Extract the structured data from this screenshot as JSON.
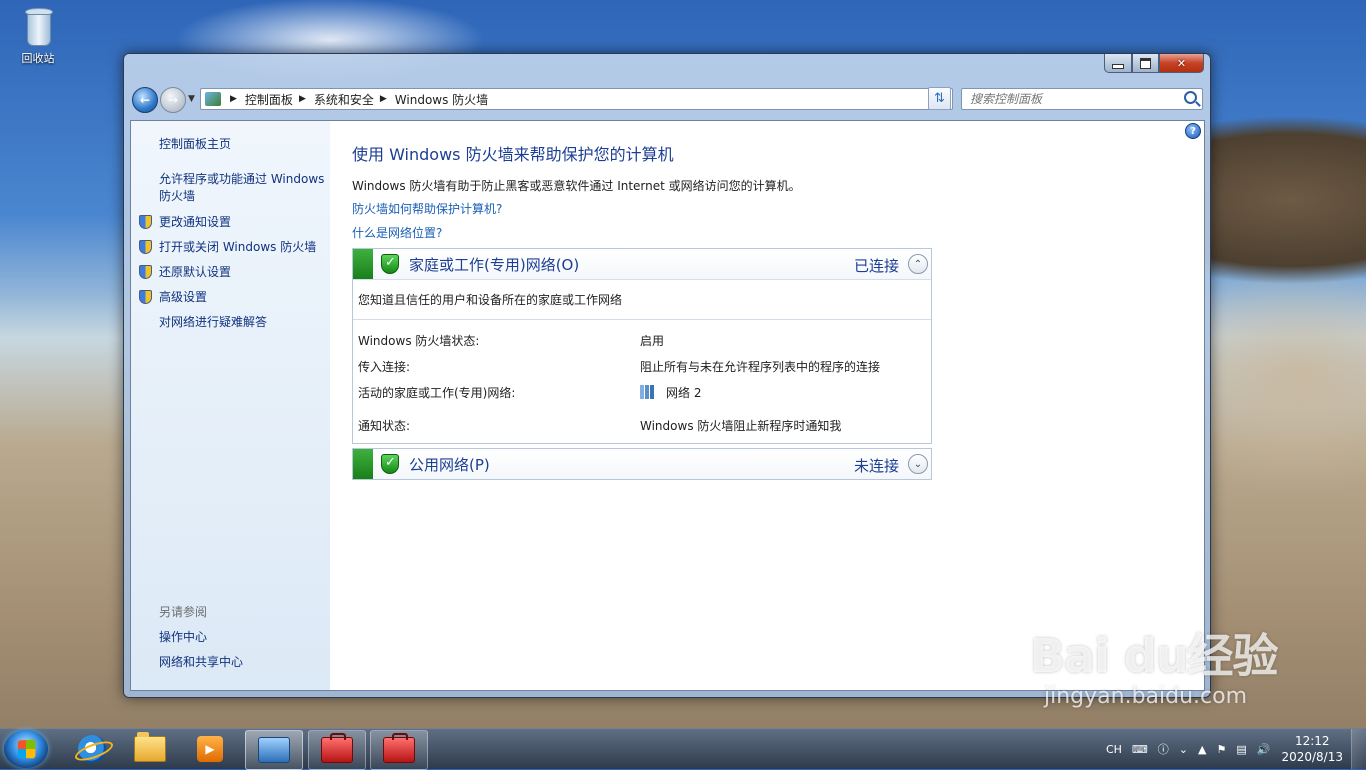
{
  "desktop": {
    "recycle_bin_label": "回收站"
  },
  "window": {
    "caption_buttons": {
      "minimize": "",
      "maximize": "",
      "close": "✕"
    },
    "nav": {
      "breadcrumbs": [
        "控制面板",
        "系统和安全",
        "Windows 防火墙"
      ],
      "search_placeholder": "搜索控制面板"
    },
    "sidebar": {
      "home": "控制面板主页",
      "allow_program": "允许程序或功能通过 Windows 防火墙",
      "items": [
        {
          "label": "更改通知设置",
          "icon": "uac-shield-icon"
        },
        {
          "label": "打开或关闭 Windows 防火墙",
          "icon": "uac-shield-icon"
        },
        {
          "label": "还原默认设置",
          "icon": "uac-shield-icon"
        },
        {
          "label": "高级设置",
          "icon": "uac-shield-icon"
        }
      ],
      "troubleshoot": "对网络进行疑难解答",
      "see_also_title": "另请参阅",
      "see_also": [
        "操作中心",
        "网络和共享中心"
      ]
    },
    "main": {
      "help_icon": "?",
      "title": "使用 Windows 防火墙来帮助保护您的计算机",
      "description": "Windows 防火墙有助于防止黑客或恶意软件通过 Internet 或网络访问您的计算机。",
      "link_how": "防火墙如何帮助保护计算机?",
      "link_location": "什么是网络位置?",
      "panels": [
        {
          "title": "家庭或工作(专用)网络(O)",
          "status": "已连接",
          "expanded": true,
          "chevron": "⌃",
          "subtitle": "您知道且信任的用户和设备所在的家庭或工作网络",
          "rows": [
            {
              "label": "Windows 防火墙状态:",
              "value": "启用"
            },
            {
              "label": "传入连接:",
              "value": "阻止所有与未在允许程序列表中的程序的连接"
            },
            {
              "label": "活动的家庭或工作(专用)网络:",
              "value": "网络  2"
            },
            {
              "label": "通知状态:",
              "value": "Windows 防火墙阻止新程序时通知我"
            }
          ]
        },
        {
          "title": "公用网络(P)",
          "status": "未连接",
          "expanded": false,
          "chevron": "⌄"
        }
      ]
    }
  },
  "taskbar": {
    "apps": [
      "internet-explorer",
      "windows-explorer",
      "media-player",
      "control-panel",
      "toolbox",
      "toolbox"
    ],
    "tray": {
      "input_lang": "CH",
      "time": "12:12",
      "date": "2020/8/13"
    }
  },
  "watermark": {
    "brand": "Bai du经验",
    "url": "jingyan.baidu.com"
  }
}
